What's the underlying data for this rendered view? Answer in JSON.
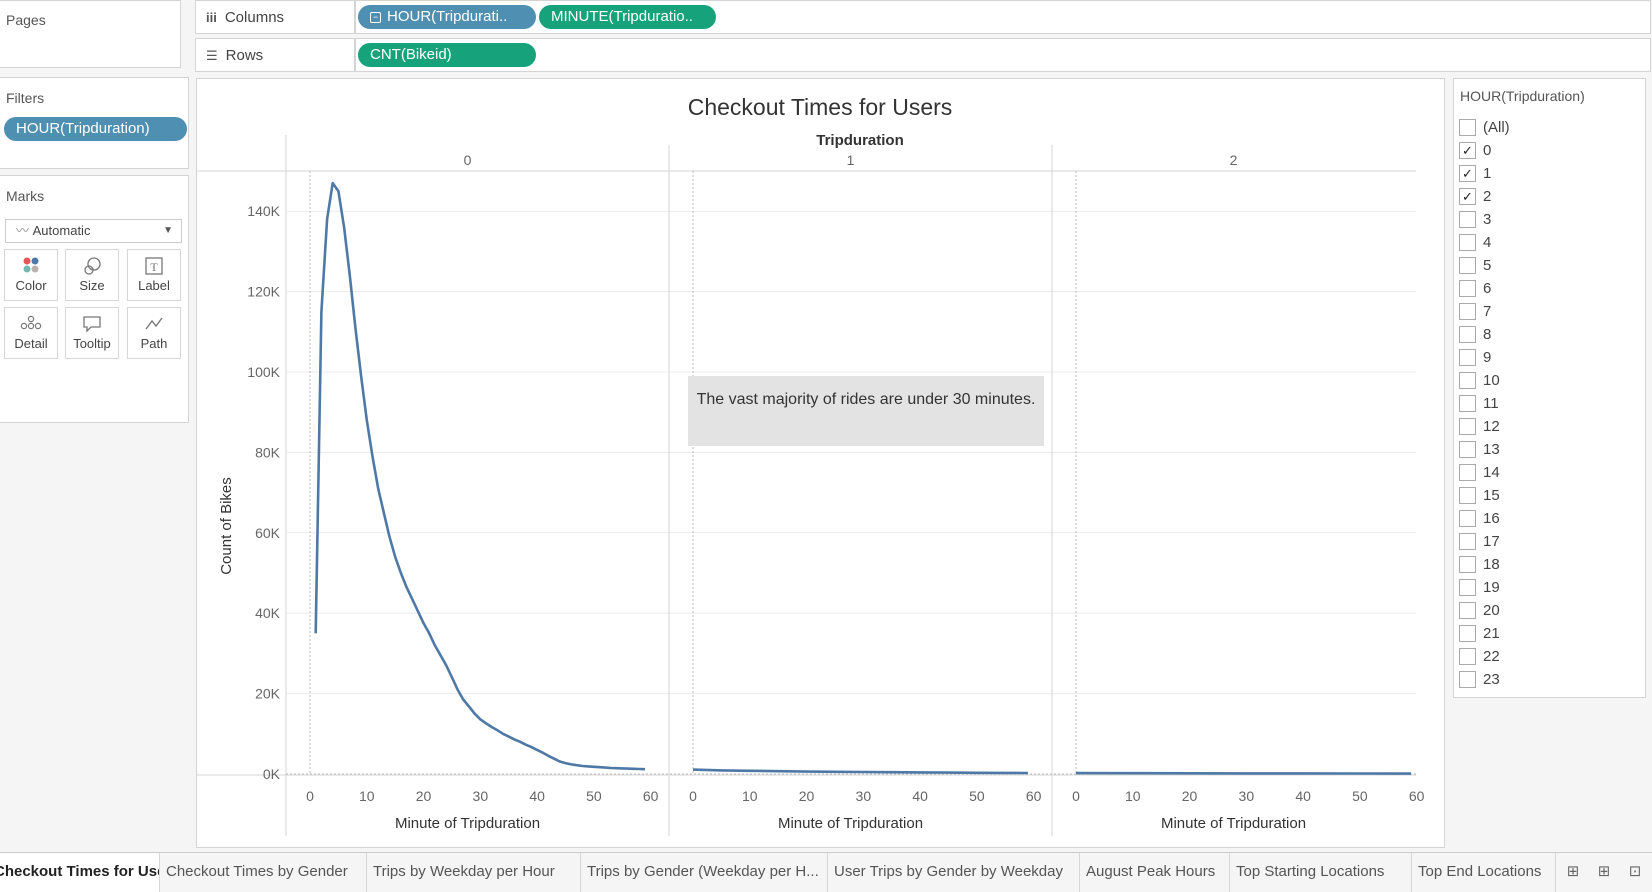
{
  "shelves": {
    "pages_title": "Pages",
    "columns_label": "Columns",
    "rows_label": "Rows",
    "columns_pills": [
      "HOUR(Tripdurati..",
      "MINUTE(Tripduratio.."
    ],
    "rows_pills": [
      "CNT(Bikeid)"
    ]
  },
  "filters": {
    "title": "Filters",
    "pill": "HOUR(Tripduration)"
  },
  "marks": {
    "title": "Marks",
    "type": "Automatic",
    "buttons": [
      "Color",
      "Size",
      "Label",
      "Detail",
      "Tooltip",
      "Path"
    ]
  },
  "view": {
    "title": "Checkout Times for Users",
    "column_header_title": "Tripduration",
    "annotation": "The vast majority of rides are under 30 minutes."
  },
  "filter_card": {
    "title": "HOUR(Tripduration)",
    "items": [
      {
        "label": "(All)",
        "checked": false
      },
      {
        "label": "0",
        "checked": true
      },
      {
        "label": "1",
        "checked": true
      },
      {
        "label": "2",
        "checked": true
      },
      {
        "label": "3",
        "checked": false
      },
      {
        "label": "4",
        "checked": false
      },
      {
        "label": "5",
        "checked": false
      },
      {
        "label": "6",
        "checked": false
      },
      {
        "label": "7",
        "checked": false
      },
      {
        "label": "8",
        "checked": false
      },
      {
        "label": "9",
        "checked": false
      },
      {
        "label": "10",
        "checked": false
      },
      {
        "label": "11",
        "checked": false
      },
      {
        "label": "12",
        "checked": false
      },
      {
        "label": "13",
        "checked": false
      },
      {
        "label": "14",
        "checked": false
      },
      {
        "label": "15",
        "checked": false
      },
      {
        "label": "16",
        "checked": false
      },
      {
        "label": "17",
        "checked": false
      },
      {
        "label": "18",
        "checked": false
      },
      {
        "label": "19",
        "checked": false
      },
      {
        "label": "20",
        "checked": false
      },
      {
        "label": "21",
        "checked": false
      },
      {
        "label": "22",
        "checked": false
      },
      {
        "label": "23",
        "checked": false
      }
    ]
  },
  "tabs": [
    "Checkout Times for Users",
    "Checkout Times by Gender",
    "Trips by Weekday per Hour",
    "Trips by Gender (Weekday per H...",
    "User Trips by Gender by Weekday",
    "August Peak Hours",
    "Top Starting Locations",
    "Top End Locations"
  ],
  "active_tab": 0,
  "chart_data": {
    "type": "line",
    "title": "Checkout Times for Users",
    "column_header": "Tripduration",
    "ylabel": "Count of Bikes",
    "xlabel": "Minute of Tripduration",
    "ylim": [
      0,
      150000
    ],
    "yticks": [
      0,
      20000,
      40000,
      60000,
      80000,
      100000,
      120000,
      140000
    ],
    "ytick_labels": [
      "0K",
      "20K",
      "40K",
      "60K",
      "80K",
      "100K",
      "120K",
      "140K"
    ],
    "xlim": [
      -3,
      62
    ],
    "xticks": [
      0,
      10,
      20,
      30,
      40,
      50,
      60
    ],
    "color": "#4e79a7",
    "panels": [
      {
        "header": "0",
        "x": [
          1,
          2,
          3,
          4,
          5,
          6,
          7,
          8,
          9,
          10,
          11,
          12,
          13,
          14,
          15,
          16,
          17,
          18,
          19,
          20,
          21,
          22,
          23,
          24,
          25,
          26,
          27,
          28,
          29,
          30,
          31,
          32,
          33,
          34,
          35,
          36,
          37,
          38,
          39,
          40,
          41,
          42,
          43,
          44,
          45,
          46,
          47,
          48,
          49,
          50,
          51,
          52,
          53,
          54,
          55,
          56,
          57,
          58,
          59
        ],
        "y": [
          35000,
          115000,
          138000,
          147000,
          145000,
          136000,
          124000,
          111000,
          99000,
          88000,
          79000,
          71000,
          65000,
          59000,
          54000,
          50000,
          46500,
          43500,
          40500,
          37500,
          35000,
          32000,
          29500,
          27000,
          24000,
          21000,
          18500,
          16800,
          15000,
          13600,
          12600,
          11700,
          10900,
          10000,
          9300,
          8600,
          8000,
          7300,
          6700,
          6000,
          5300,
          4500,
          3800,
          3100,
          2700,
          2400,
          2200,
          2000,
          1900,
          1800,
          1700,
          1600,
          1500,
          1450,
          1400,
          1350,
          1300,
          1250,
          1200
        ]
      },
      {
        "header": "1",
        "x": [
          0,
          5,
          10,
          15,
          20,
          25,
          30,
          35,
          40,
          45,
          50,
          55,
          59
        ],
        "y": [
          1100,
          900,
          800,
          700,
          600,
          550,
          500,
          450,
          400,
          350,
          300,
          280,
          250
        ]
      },
      {
        "header": "2",
        "x": [
          0,
          10,
          20,
          30,
          40,
          50,
          59
        ],
        "y": [
          220,
          200,
          180,
          160,
          140,
          120,
          100
        ]
      }
    ]
  }
}
